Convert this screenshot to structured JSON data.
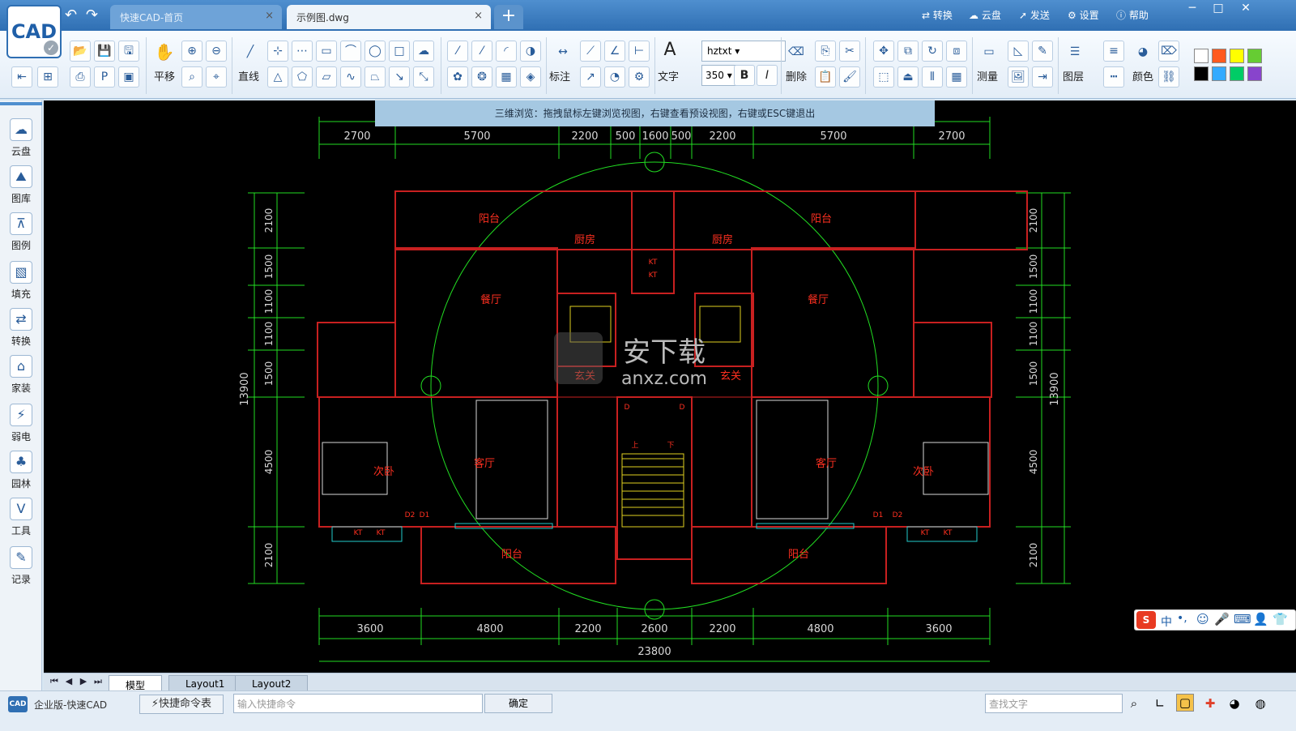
{
  "window": {
    "tabs": [
      {
        "label": "快速CAD-首页"
      },
      {
        "label": "示例图.dwg"
      }
    ],
    "tab_close": "×",
    "new_tab": "+",
    "logo": "CAD",
    "top_right": {
      "convert": "转换",
      "cloud": "云盘",
      "send": "发送",
      "settings": "设置",
      "help": "帮助"
    },
    "controls": {
      "min": "─",
      "max": "□",
      "close": "✕"
    }
  },
  "ribbon": {
    "pan": "平移",
    "line": "直线",
    "annotate": "标注",
    "text": "文字",
    "delete": "删除",
    "measure": "测量",
    "layer": "图层",
    "color": "颜色",
    "font_value": "hztxt",
    "size_value": "350",
    "bold": "B",
    "italic": "I",
    "swatches": [
      "#ffffff",
      "#ff5a1f",
      "#ffff00",
      "#66cc33",
      "#000000",
      "#33aaff",
      "#00cc66",
      "#8844cc"
    ]
  },
  "sidebar": [
    "云盘",
    "图库",
    "图例",
    "填充",
    "转换",
    "家装",
    "弱电",
    "园林",
    "工具",
    "记录"
  ],
  "hint": "三维浏览：拖拽鼠标左键浏览视图，右键查看预设视图，右键或ESC键退出",
  "drawing": {
    "top_dims": [
      "2700",
      "5700",
      "2200",
      "500",
      "1600",
      "500",
      "2200",
      "5700",
      "2700"
    ],
    "bottom_dims": [
      "3600",
      "4800",
      "2200",
      "2600",
      "2200",
      "4800",
      "3600"
    ],
    "total": "23800",
    "left_dims": [
      "2100",
      "1500",
      "1100",
      "1100",
      "1500",
      "4500",
      "2100"
    ],
    "right_dims": [
      "2100",
      "1500",
      "1100",
      "1100",
      "1500",
      "4500",
      "2100"
    ],
    "side_total": "13900",
    "rooms": [
      {
        "t": "阳台"
      },
      {
        "t": "厨房"
      },
      {
        "t": "厨房"
      },
      {
        "t": "阳台"
      },
      {
        "t": "餐厅"
      },
      {
        "t": "餐厅"
      },
      {
        "t": "玄关"
      },
      {
        "t": "玄关"
      },
      {
        "t": "客厅"
      },
      {
        "t": "客厅"
      },
      {
        "t": "次卧"
      },
      {
        "t": "次卧"
      },
      {
        "t": "阳台"
      },
      {
        "t": "阳台"
      }
    ],
    "marks": [
      "D",
      "D",
      "D1",
      "D2",
      "D1",
      "D2",
      "KT",
      "KT",
      "KT",
      "KT",
      "KT",
      "KT"
    ],
    "stair": [
      "上",
      "下"
    ],
    "watermark": "安下载",
    "watermark_url": "anxz.com"
  },
  "layout_tabs": [
    "模型",
    "Layout1",
    "Layout2"
  ],
  "status": {
    "edition": "企业版-快速CAD",
    "cmd_table": "⚡快捷命令表",
    "cmd_placeholder": "输入快捷命令",
    "ok": "确定",
    "search_placeholder": "查找文字"
  },
  "ime": {
    "brand": "S",
    "mode": "中"
  }
}
